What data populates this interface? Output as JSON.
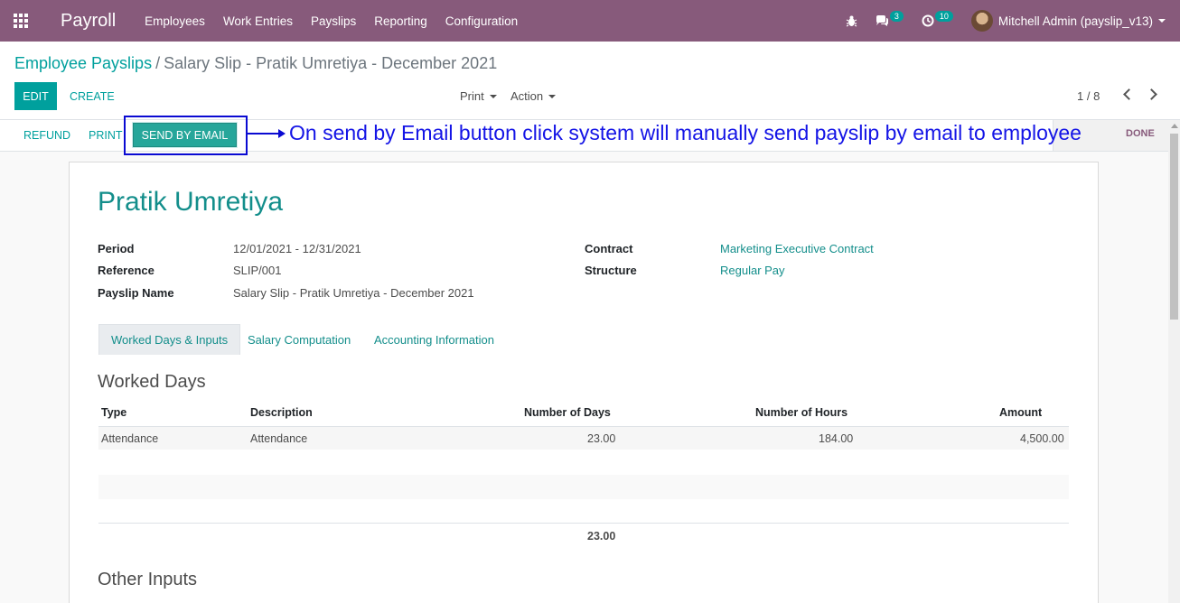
{
  "navbar": {
    "app_name": "Payroll",
    "menu": [
      "Employees",
      "Work Entries",
      "Payslips",
      "Reporting",
      "Configuration"
    ],
    "messages_count": "3",
    "activities_count": "10",
    "user": "Mitchell Admin (payslip_v13)",
    "bg_color": "#875a7b"
  },
  "breadcrumb": {
    "parent": "Employee Payslips",
    "separator": "/",
    "current": "Salary Slip - Pratik Umretiya - December 2021"
  },
  "toolbar": {
    "edit": "EDIT",
    "create": "CREATE",
    "print": "Print",
    "action": "Action",
    "pager": "1 / 8"
  },
  "statusbar": {
    "refund": "REFUND",
    "print": "PRINT",
    "send_by_email": "SEND BY EMAIL",
    "stage": "DONE"
  },
  "annotation": "On send by Email button click system will manually send payslip by email to employee",
  "form": {
    "employee": "Pratik Umretiya",
    "fields": {
      "period_label": "Period",
      "period_value": "12/01/2021 - 12/31/2021",
      "reference_label": "Reference",
      "reference_value": "SLIP/001",
      "payslip_name_label": "Payslip Name",
      "payslip_name_value": "Salary Slip - Pratik Umretiya - December 2021",
      "contract_label": "Contract",
      "contract_value": "Marketing Executive Contract",
      "structure_label": "Structure",
      "structure_value": "Regular Pay"
    },
    "tabs": [
      "Worked Days & Inputs",
      "Salary Computation",
      "Accounting Information"
    ],
    "worked_days": {
      "title": "Worked Days",
      "columns": [
        "Type",
        "Description",
        "Number of Days",
        "Number of Hours",
        "Amount"
      ],
      "rows": [
        {
          "type": "Attendance",
          "description": "Attendance",
          "days": "23.00",
          "hours": "184.00",
          "amount": "4,500.00"
        }
      ],
      "total_days": "23.00"
    },
    "other_inputs_title": "Other Inputs"
  }
}
